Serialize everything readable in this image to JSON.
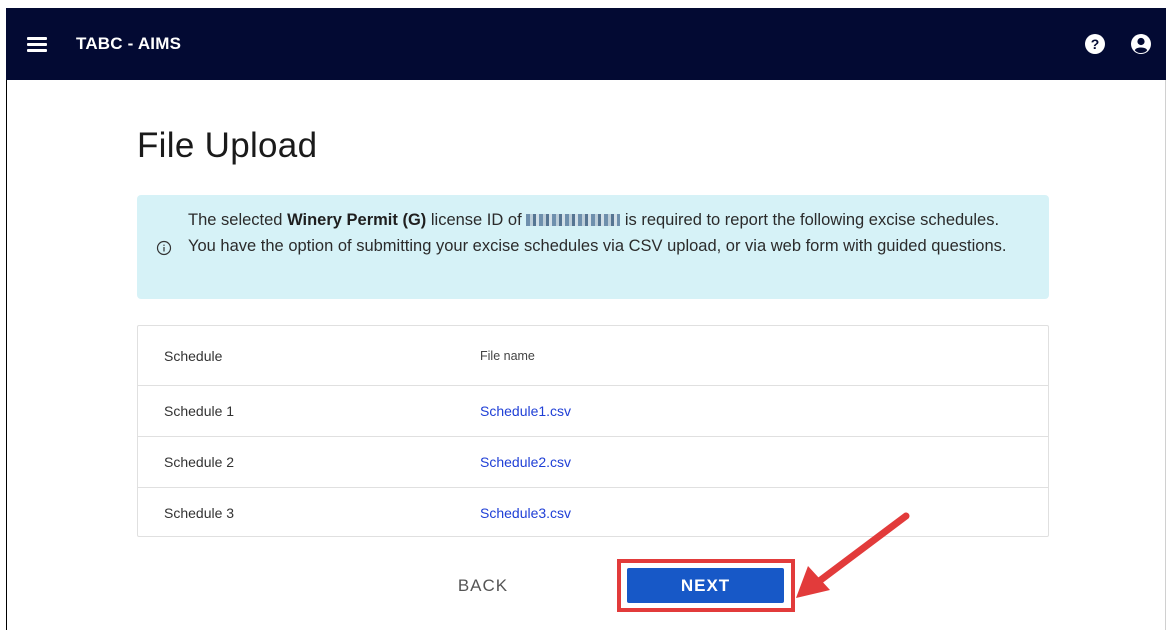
{
  "appbar": {
    "title": "TABC - AIMS",
    "menu_icon": "hamburger-menu-icon",
    "help_icon": "help-circle-icon",
    "account_icon": "account-circle-icon",
    "background_color": "#030a33"
  },
  "page": {
    "title": "File Upload"
  },
  "info": {
    "text_before_bold": "The selected ",
    "bold_text": "Winery Permit (G)",
    "text_after_bold": " license ID of ",
    "text_after_id": " is required to report the following excise schedules. You have the option of submitting your excise schedules via CSV upload, or via web form with guided questions.",
    "icon": "info-icon",
    "background_color": "#d6f2f7"
  },
  "table": {
    "headers": [
      "Schedule",
      "File name"
    ],
    "rows": [
      {
        "schedule": "Schedule 1",
        "file": "Schedule1.csv"
      },
      {
        "schedule": "Schedule 2",
        "file": "Schedule2.csv"
      },
      {
        "schedule": "Schedule 3",
        "file": "Schedule3.csv"
      }
    ]
  },
  "actions": {
    "back_label": "BACK",
    "next_label": "NEXT",
    "next_color": "#1758c7",
    "highlight_color": "#e23b3b"
  }
}
